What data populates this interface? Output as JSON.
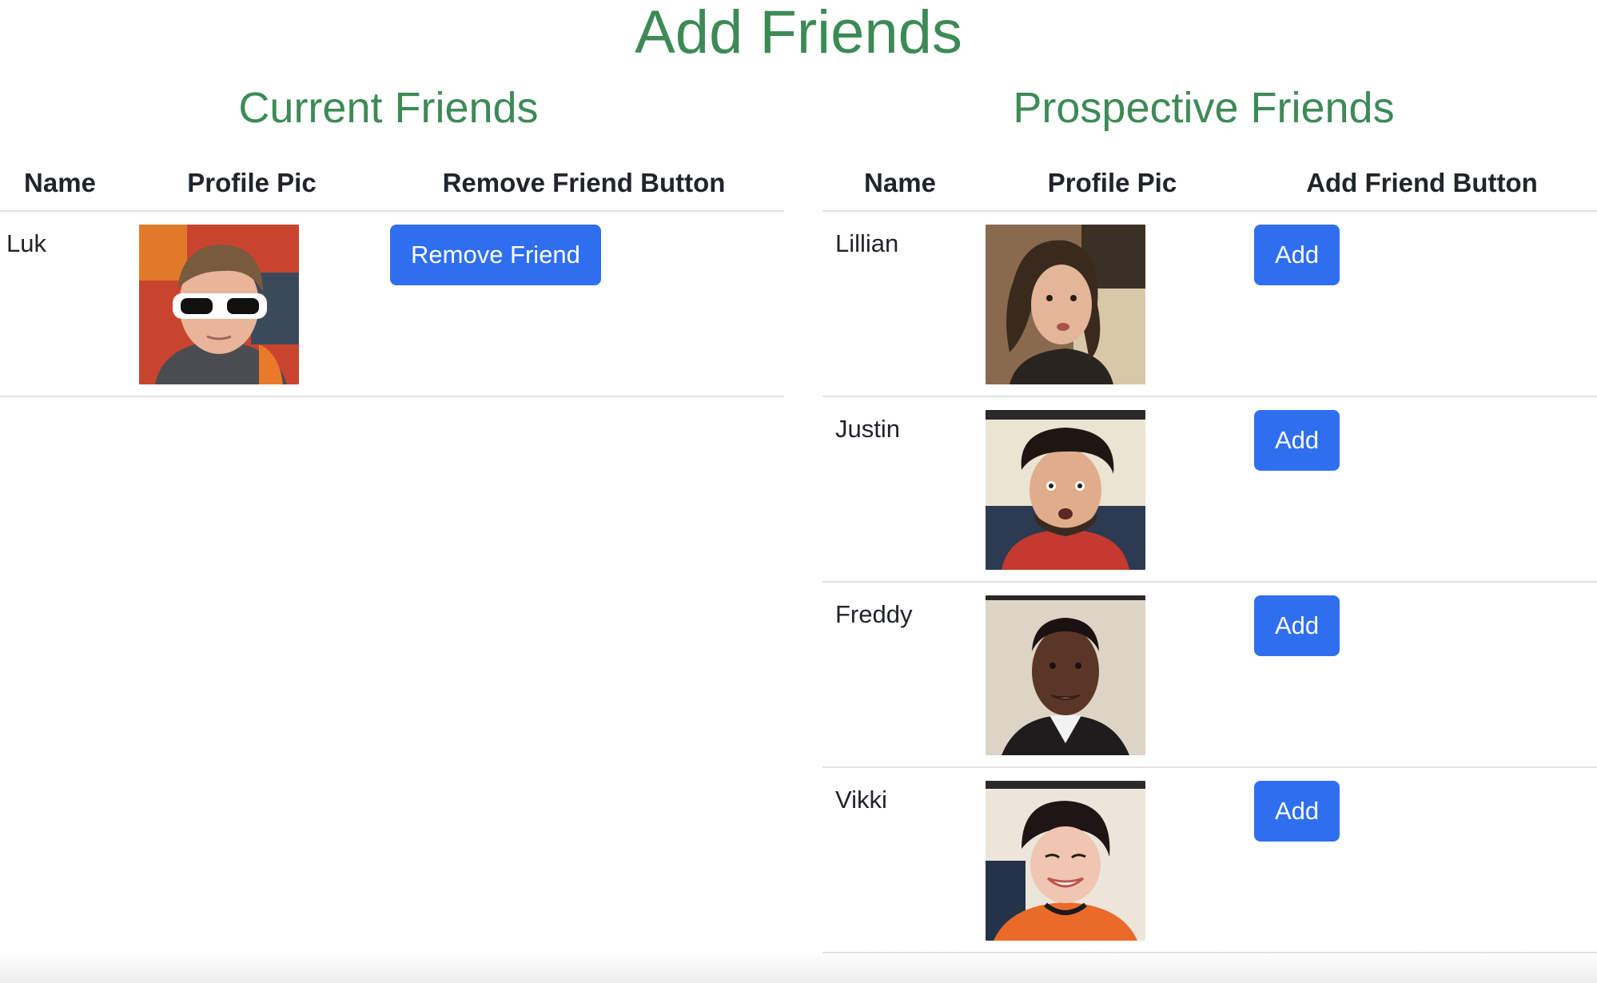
{
  "page": {
    "title": "Add Friends",
    "accent_color": "#3d8a56",
    "button_color": "#2f6fef"
  },
  "current": {
    "title": "Current Friends",
    "headers": [
      "Name",
      "Profile Pic",
      "Remove Friend Button"
    ],
    "rows": [
      {
        "name": "Luk",
        "avatar": "person-photo-sunglasses",
        "button": "Remove Friend"
      }
    ]
  },
  "prospective": {
    "title": "Prospective Friends",
    "headers": [
      "Name",
      "Profile Pic",
      "Add Friend Button"
    ],
    "rows": [
      {
        "name": "Lillian",
        "avatar": "person-photo",
        "button": "Add"
      },
      {
        "name": "Justin",
        "avatar": "person-photo",
        "button": "Add"
      },
      {
        "name": "Freddy",
        "avatar": "person-photo",
        "button": "Add"
      },
      {
        "name": "Vikki",
        "avatar": "person-photo",
        "button": "Add"
      }
    ]
  }
}
